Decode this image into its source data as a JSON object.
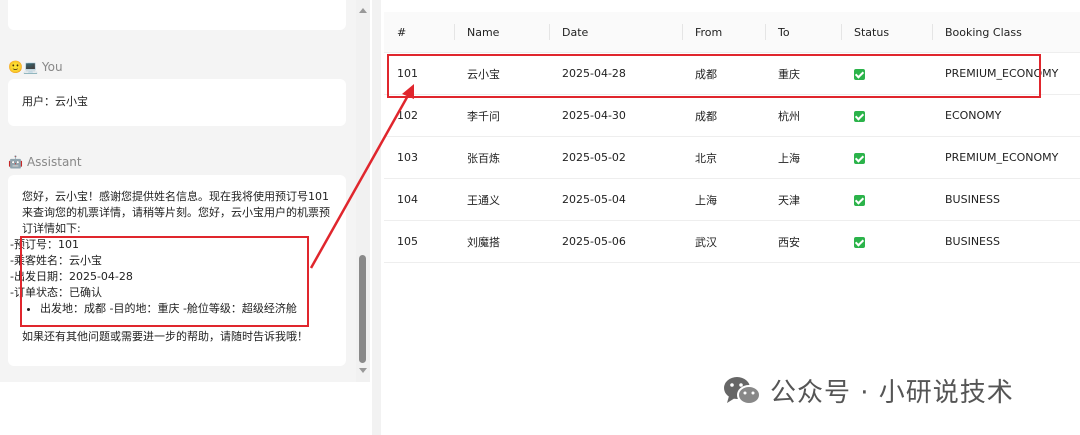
{
  "chat": {
    "truncated_top": "¬",
    "user": {
      "role_emoji": "🙂💻",
      "role": "You",
      "message": "用户：云小宝"
    },
    "assistant": {
      "role_emoji": "🤖",
      "role": "Assistant",
      "intro": "您好，云小宝！感谢您提供姓名信息。现在我将使用预订号101来查询您的机票详情，请稍等片刻。您好，云小宝用户的机票预订详情如下:",
      "details": [
        "-预订号：101",
        "-乘客姓名：云小宝",
        "-出发日期：2025-04-28",
        "-订单状态：已确认"
      ],
      "bullet": "出发地：成都 -目的地：重庆 -舱位等级：超级经济舱",
      "closing": "如果还有其他问题或需要进一步的帮助，请随时告诉我哦！"
    }
  },
  "table": {
    "headers": [
      "#",
      "Name",
      "Date",
      "From",
      "To",
      "Status",
      "Booking Class"
    ],
    "rows": [
      [
        "101",
        "云小宝",
        "2025-04-28",
        "成都",
        "重庆",
        "PREMIUM_ECONOMY"
      ],
      [
        "102",
        "李千问",
        "2025-04-30",
        "成都",
        "杭州",
        "ECONOMY"
      ],
      [
        "103",
        "张百炼",
        "2025-05-02",
        "北京",
        "上海",
        "PREMIUM_ECONOMY"
      ],
      [
        "104",
        "王通义",
        "2025-05-04",
        "上海",
        "天津",
        "BUSINESS"
      ],
      [
        "105",
        "刘魔搭",
        "2025-05-06",
        "武汉",
        "西安",
        "BUSINESS"
      ]
    ],
    "status_icon": "check-square-icon",
    "status_color": "#2bb34a"
  },
  "annotation": {
    "highlight_color": "#e0262d"
  },
  "watermark": {
    "text": "公众号 · 小研说技术",
    "icon": "wechat-icon"
  }
}
